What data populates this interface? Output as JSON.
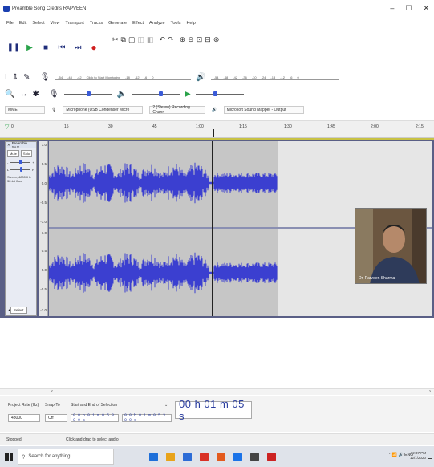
{
  "window": {
    "title": "Preamble Song Credits RAPVEEN",
    "minimize": "–",
    "maximize": "☐",
    "close": "✕"
  },
  "menu": [
    "File",
    "Edit",
    "Select",
    "View",
    "Transport",
    "Tracks",
    "Generate",
    "Effect",
    "Analyze",
    "Tools",
    "Help"
  ],
  "transport": {
    "pause": "❚❚",
    "play": "▶",
    "stop": "■",
    "skip_start": "⏮",
    "skip_end": "⏭",
    "record": "●"
  },
  "meters": {
    "record_ticks": [
      "-54",
      "-48",
      "-42"
    ],
    "record_hint": "Click to Start Monitoring",
    "record_ticks_b": [
      "-18",
      "-12",
      "-6",
      "0"
    ],
    "play_ticks": [
      "-54",
      "-48",
      "-42",
      "-36",
      "-30",
      "-24",
      "-18",
      "-12",
      "-6",
      "0"
    ]
  },
  "devices": {
    "host": "MME",
    "mic": "Microphone (USB Condenser Micro",
    "channels": "2 (Stereo) Recording Chann",
    "speaker": "Microsoft Sound Mapper - Output"
  },
  "timeline": {
    "ticks": [
      "0",
      "15",
      "30",
      "45",
      "1:00",
      "1:15",
      "1:30",
      "1:45",
      "2:00",
      "2:15"
    ]
  },
  "track": {
    "name": "Preamble So▼",
    "close": "✕",
    "mute": "Mute",
    "solo": "Solo",
    "gain_minus": "-",
    "gain_plus": "+",
    "pan_l": "L",
    "pan_r": "R",
    "info_line1": "Stereo, 48000Hz",
    "info_line2": "32-bit float",
    "select": "Select",
    "collapse": "▲",
    "scale": [
      "1.0",
      "0.5",
      "0.0",
      "-0.5",
      "-1.0",
      "1.0",
      "0.5",
      "0.0",
      "-0.5",
      "-1.0"
    ]
  },
  "webcam": {
    "label": "Dr. Parveen Sharma"
  },
  "selection_toolbar": {
    "project_rate_label": "Project Rate (Hz)",
    "snap_to_label": "Snap-To",
    "selection_mode_label": "Start and End of Selection",
    "project_rate": "48000",
    "snap_to": "Off",
    "start_time": "0 0 h 0 1 m 0 5.3 0 9 s",
    "end_time": "0 0 h 0 1 m 0 5.3 0 9 s",
    "big_time": "00 h 01 m 05 s"
  },
  "status": {
    "state": "Stopped.",
    "hint": "Click and drag to select audio"
  },
  "taskbar": {
    "search_placeholder": "Search for anything",
    "tray": "^ 📶 🔊 ENG",
    "time": "12:37 PM",
    "date": "12/1/2020",
    "app_colors": [
      "#1e6fd9",
      "#e8a31a",
      "#2b6bd6",
      "#d93025",
      "#e35a1e",
      "#1a73e8",
      "#444444",
      "#cc2222"
    ]
  },
  "colors": {
    "waveform": "#3b3fd0",
    "track_bg": "#5a5f86",
    "accent_border": "#c8c244",
    "time_text": "#2a3d9e"
  }
}
